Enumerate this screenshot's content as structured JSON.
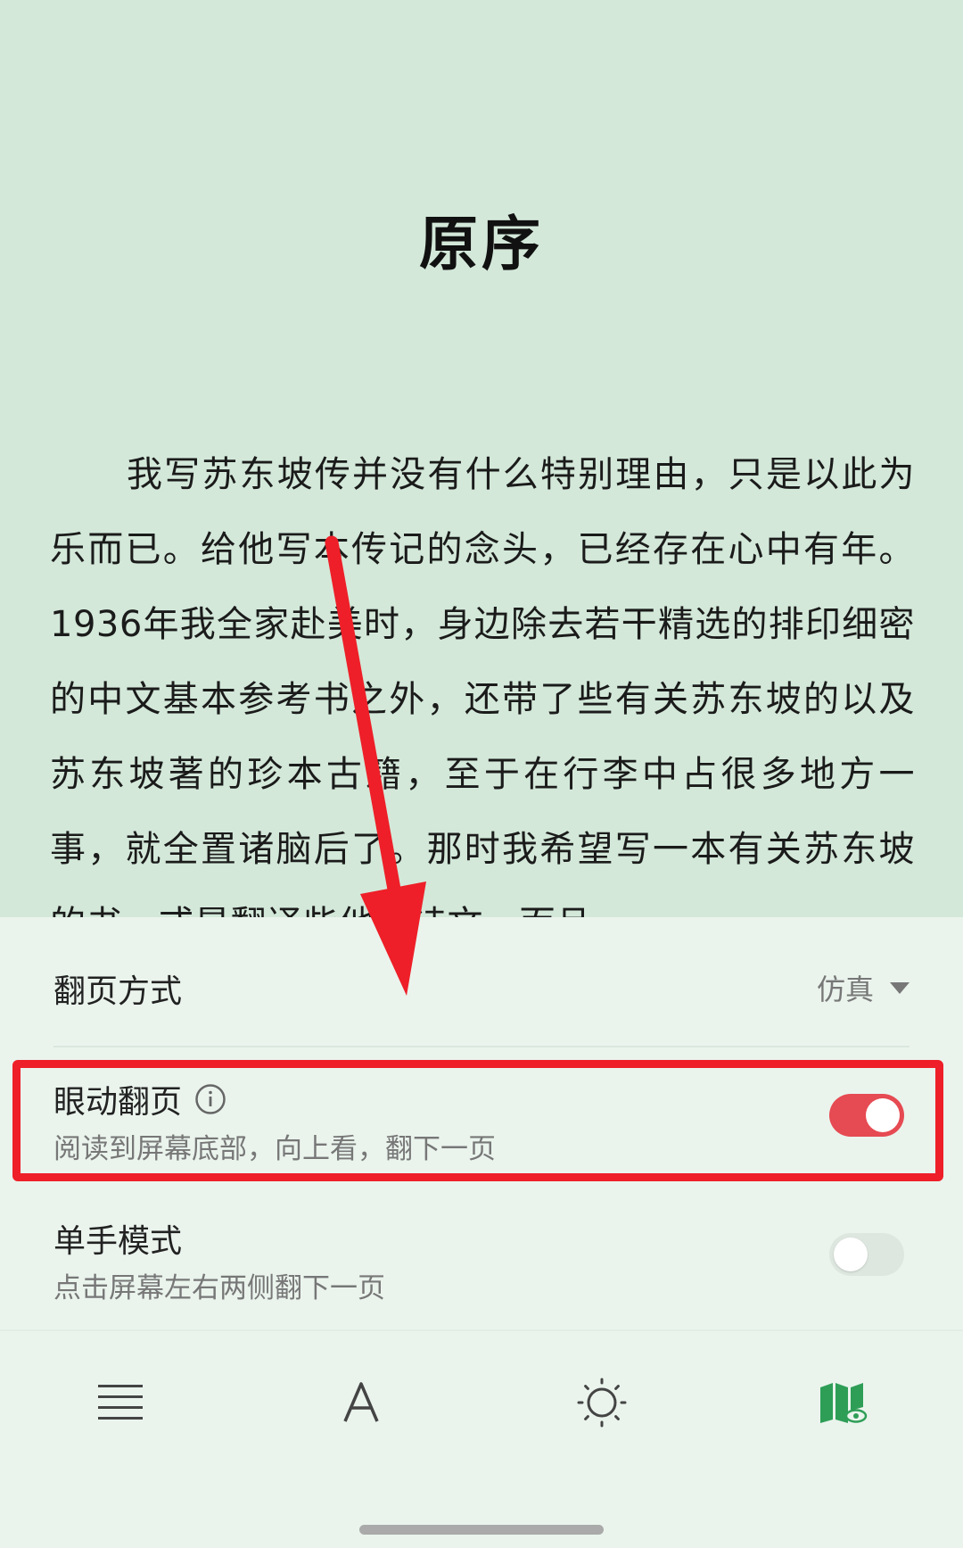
{
  "reader": {
    "chapter_title": "原序",
    "body_text": "我写苏东坡传并没有什么特别理由，只是以此为乐而已。给他写本传记的念头，已经存在心中有年。1936年我全家赴美时，身边除去若干精选的排印细密的中文基本参考书之外，还带了些有关苏东坡的以及苏东坡著的珍本古籍，至于在行李中占很多地方一事，就全置诸脑后了。那时我希望写一本有关苏东坡的书，或是翻译些他的诗文，而且"
  },
  "settings": {
    "page_turn": {
      "label": "翻页方式",
      "value": "仿真"
    },
    "eye_turn": {
      "title": "眼动翻页",
      "desc": "阅读到屏幕底部，向上看，翻下一页",
      "enabled": true
    },
    "one_hand": {
      "title": "单手模式",
      "desc": "点击屏幕左右两侧翻下一页",
      "enabled": false
    }
  },
  "toolbar": {
    "items": [
      "menu-icon",
      "font-icon",
      "brightness-icon",
      "reading-mode-icon"
    ]
  },
  "colors": {
    "reader_bg": "#d3e8d9",
    "panel_bg": "#eaf4ed",
    "toggle_on": "#e64a52",
    "annotation_red": "#ee1f28",
    "active_tool_green": "#2e9e57"
  }
}
